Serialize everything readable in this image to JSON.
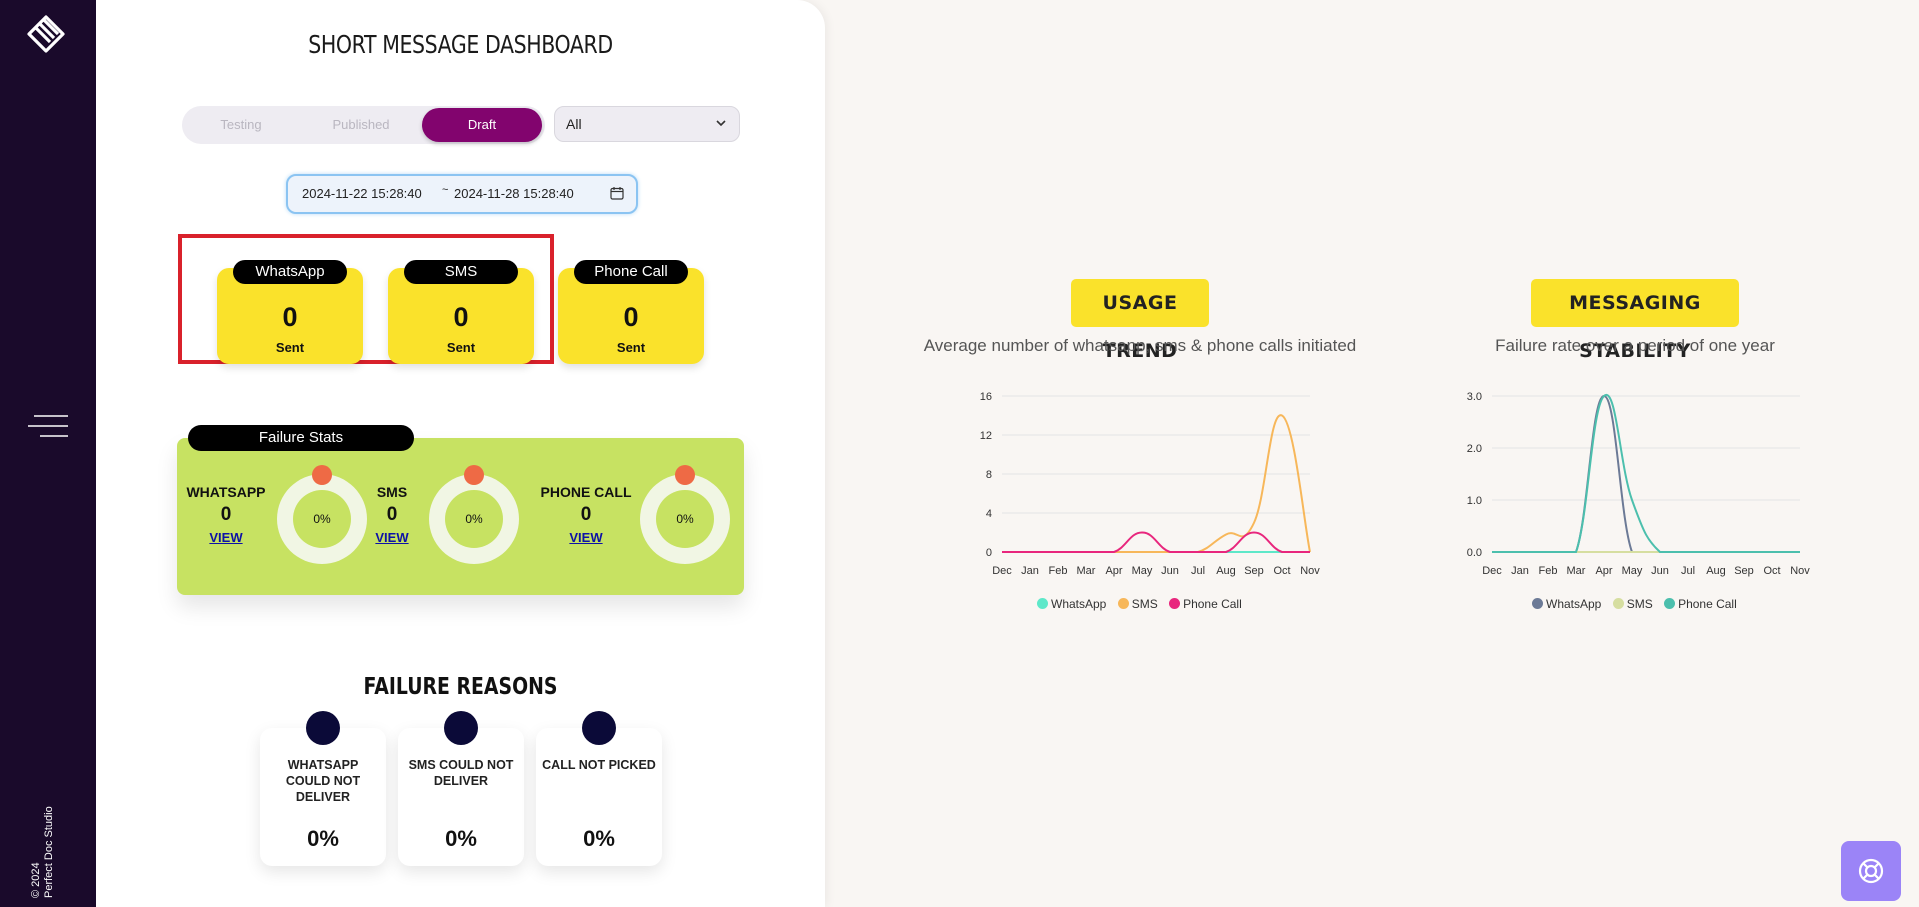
{
  "sidebar": {
    "logo_icon": "stacked-layers-logo",
    "menu_icon": "hamburger-menu-icon",
    "copyright_line1": "© 2024",
    "copyright_line2": "Perfect Doc Studio"
  },
  "header": {
    "title": "SHORT MESSAGE DASHBOARD"
  },
  "filters": {
    "tabs": [
      {
        "label": "Testing",
        "active": false
      },
      {
        "label": "Published",
        "active": false
      },
      {
        "label": "Draft",
        "active": true
      }
    ],
    "select_value": "All",
    "date_from": "2024-11-22 15:28:40",
    "date_separator": "~",
    "date_to": "2024-11-28 15:28:40",
    "date_icon": "calendar-icon"
  },
  "sent": [
    {
      "channel": "WhatsApp",
      "count": "0",
      "label": "Sent"
    },
    {
      "channel": "SMS",
      "count": "0",
      "label": "Sent"
    },
    {
      "channel": "Phone Call",
      "count": "0",
      "label": "Sent"
    }
  ],
  "failure_stats": {
    "title": "Failure Stats",
    "items": [
      {
        "name": "WHATSAPP",
        "value": "0",
        "link": "VIEW",
        "percent": "0%"
      },
      {
        "name": "SMS",
        "value": "0",
        "link": "VIEW",
        "percent": "0%"
      },
      {
        "name": "PHONE CALL",
        "value": "0",
        "link": "VIEW",
        "percent": "0%"
      }
    ]
  },
  "failure_reasons": {
    "title": "FAILURE REASONS",
    "items": [
      {
        "label": "WHATSAPP COULD NOT DELIVER",
        "value": "0%"
      },
      {
        "label": "SMS COULD NOT DELIVER",
        "value": "0%"
      },
      {
        "label": "CALL NOT PICKED",
        "value": "0%"
      }
    ]
  },
  "charts": {
    "usage": {
      "badge": "USAGE TREND",
      "subtitle": "Average number of whatsapp, sms & phone calls initiated"
    },
    "stability": {
      "badge": "MESSAGING STABILITY",
      "subtitle": "Failure rate over a period of one year"
    }
  },
  "chart_data": [
    {
      "type": "line",
      "title": "USAGE TREND",
      "subtitle": "Average number of whatsapp, sms & phone calls initiated",
      "x": [
        "Dec",
        "Jan",
        "Feb",
        "Mar",
        "Apr",
        "May",
        "Jun",
        "Jul",
        "Aug",
        "Sep",
        "Oct",
        "Nov"
      ],
      "yticks": [
        "0",
        "4",
        "8",
        "12",
        "16"
      ],
      "ylim": [
        0,
        16
      ],
      "grid": true,
      "legend_position": "bottom",
      "series": [
        {
          "name": "WhatsApp",
          "color": "#5ee8c9",
          "values": [
            0,
            0,
            0,
            0,
            0,
            0,
            0,
            0,
            0,
            0,
            0,
            0
          ]
        },
        {
          "name": "SMS",
          "color": "#f7b75a",
          "values": [
            0,
            0,
            0,
            0,
            0,
            0,
            0,
            0,
            1.8,
            3,
            14,
            0
          ]
        },
        {
          "name": "Phone Call",
          "color": "#e8267d",
          "values": [
            0,
            0,
            0,
            0,
            0,
            2,
            0,
            0,
            0,
            2,
            0,
            0
          ]
        }
      ]
    },
    {
      "type": "line",
      "title": "MESSAGING STABILITY",
      "subtitle": "Failure rate over a period of one year",
      "x": [
        "Dec",
        "Jan",
        "Feb",
        "Mar",
        "Apr",
        "May",
        "Jun",
        "Jul",
        "Aug",
        "Sep",
        "Oct",
        "Nov"
      ],
      "yticks": [
        "0.0",
        "1.0",
        "2.0",
        "3.0"
      ],
      "ylim": [
        0,
        3
      ],
      "grid": true,
      "legend_position": "bottom",
      "series": [
        {
          "name": "WhatsApp",
          "color": "#6c7a96",
          "values": [
            0,
            0,
            0,
            0,
            3,
            0,
            0,
            0,
            0,
            0,
            0,
            0
          ]
        },
        {
          "name": "SMS",
          "color": "#d6dea0",
          "values": [
            0,
            0,
            0,
            0,
            0,
            0,
            0,
            0,
            0,
            0,
            0,
            0
          ]
        },
        {
          "name": "Phone Call",
          "color": "#4cbfad",
          "values": [
            0,
            0,
            0,
            0,
            3,
            1,
            0,
            0,
            0,
            0,
            0,
            0
          ]
        }
      ]
    }
  ],
  "help": {
    "icon": "lifebuoy-help-icon"
  }
}
